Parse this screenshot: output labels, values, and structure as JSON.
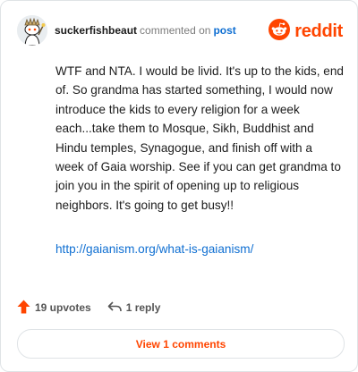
{
  "colors": {
    "brand": "#ff4500",
    "link": "#0f6fd2",
    "upvote": "#ff4500",
    "border": "#dfe3e6"
  },
  "header": {
    "username": "suckerfishbeaut",
    "action": "commented on",
    "target": "post",
    "brand_name": "reddit",
    "avatar_icon": "snoo-avatar-icon",
    "logo_icon": "reddit-snoo-logo-icon"
  },
  "comment": {
    "text": "WTF and NTA. I would be livid. It's up to the kids, end of. So grandma has started something, I would now introduce the kids to every religion for a week each...take them to Mosque, Sikh, Buddhist and Hindu temples, Synagogue, and finish off with a week of Gaia worship. See if you can get grandma to join you in the spirit of opening up to religious neighbors. It's going to get busy!!",
    "link": "http://gaianism.org/what-is-gaianism/"
  },
  "actions": {
    "upvotes": "19 upvotes",
    "upvote_icon": "upvote-arrow-icon",
    "reply": "1 reply",
    "reply_icon": "reply-arrow-icon"
  },
  "footer": {
    "view_comments": "View 1 comments"
  }
}
